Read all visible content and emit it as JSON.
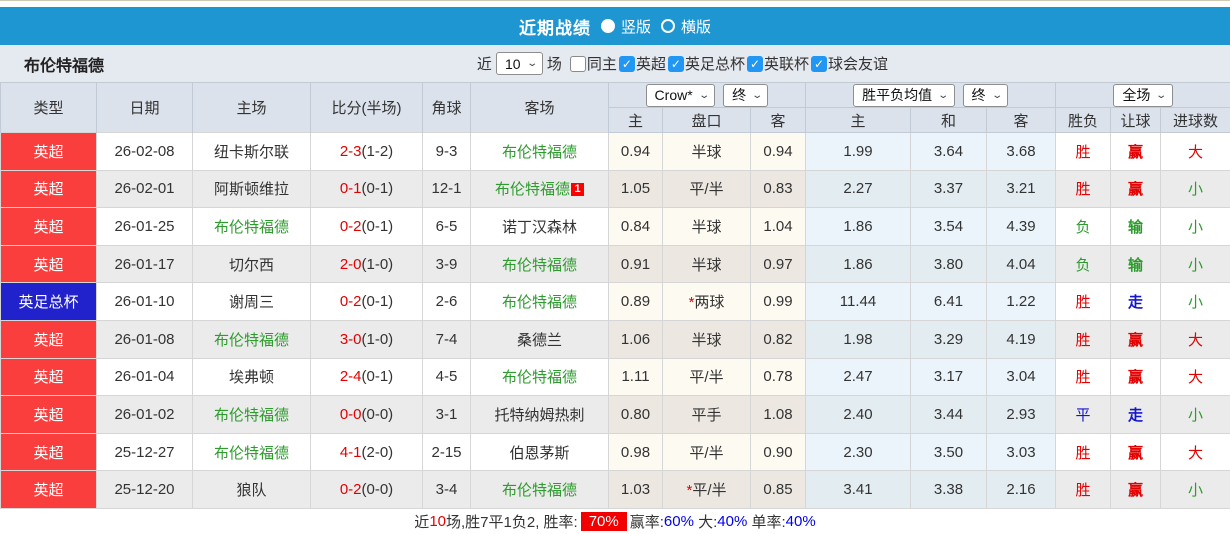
{
  "topbar": {
    "title": "近期战绩",
    "radios": [
      {
        "label": "竖版",
        "selected": true
      },
      {
        "label": "横版",
        "selected": false
      }
    ]
  },
  "filter": {
    "team": "布伦特福德",
    "recent_prefix": "近",
    "recent_value": "10",
    "recent_suffix": "场",
    "checkboxes": [
      {
        "label": "同主",
        "checked": false
      },
      {
        "label": "英超",
        "checked": true
      },
      {
        "label": "英足总杯",
        "checked": true
      },
      {
        "label": "英联杯",
        "checked": true
      },
      {
        "label": "球会友谊",
        "checked": true
      }
    ]
  },
  "table": {
    "left_headers": [
      "类型",
      "日期",
      "主场",
      "比分(半场)",
      "角球",
      "客场"
    ],
    "dropdowns": {
      "odds_company": "Crow*",
      "odds_final": "终",
      "avg_label": "胜平负均值",
      "avg_final": "终",
      "fulltime": "全场"
    },
    "sub_headers": [
      "主",
      "盘口",
      "客",
      "主",
      "和",
      "客",
      "胜负",
      "让球",
      "进球数"
    ],
    "rows": [
      {
        "league": "英超",
        "league_color": "red",
        "date": "26-02-08",
        "home": "纽卡斯尔联",
        "home_team": false,
        "score": "2-3",
        "half": "(1-2)",
        "corners": "9-3",
        "away": "布伦特福德",
        "away_team": true,
        "away_badge": "",
        "o1": "0.94",
        "handicap": "半球",
        "handicap_star": false,
        "o2": "0.94",
        "a1": "1.99",
        "a2": "3.64",
        "a3": "3.68",
        "res": "胜",
        "res_c": "red",
        "hres": "赢",
        "hres_c": "red",
        "goal": "大",
        "goal_c": "red"
      },
      {
        "league": "英超",
        "league_color": "red",
        "date": "26-02-01",
        "home": "阿斯顿维拉",
        "home_team": false,
        "score": "0-1",
        "half": "(0-1)",
        "corners": "12-1",
        "away": "布伦特福德",
        "away_team": true,
        "away_badge": "1",
        "o1": "1.05",
        "handicap": "平/半",
        "handicap_star": false,
        "o2": "0.83",
        "a1": "2.27",
        "a2": "3.37",
        "a3": "3.21",
        "res": "胜",
        "res_c": "red",
        "hres": "赢",
        "hres_c": "red",
        "goal": "小",
        "goal_c": "green"
      },
      {
        "league": "英超",
        "league_color": "red",
        "date": "26-01-25",
        "home": "布伦特福德",
        "home_team": true,
        "score": "0-2",
        "half": "(0-1)",
        "corners": "6-5",
        "away": "诺丁汉森林",
        "away_team": false,
        "away_badge": "",
        "o1": "0.84",
        "handicap": "半球",
        "handicap_star": false,
        "o2": "1.04",
        "a1": "1.86",
        "a2": "3.54",
        "a3": "4.39",
        "res": "负",
        "res_c": "green",
        "hres": "输",
        "hres_c": "green",
        "goal": "小",
        "goal_c": "green"
      },
      {
        "league": "英超",
        "league_color": "red",
        "date": "26-01-17",
        "home": "切尔西",
        "home_team": false,
        "score": "2-0",
        "half": "(1-0)",
        "corners": "3-9",
        "away": "布伦特福德",
        "away_team": true,
        "away_badge": "",
        "o1": "0.91",
        "handicap": "半球",
        "handicap_star": false,
        "o2": "0.97",
        "a1": "1.86",
        "a2": "3.80",
        "a3": "4.04",
        "res": "负",
        "res_c": "green",
        "hres": "输",
        "hres_c": "green",
        "goal": "小",
        "goal_c": "green"
      },
      {
        "league": "英足总杯",
        "league_color": "blue",
        "date": "26-01-10",
        "home": "谢周三",
        "home_team": false,
        "score": "0-2",
        "half": "(0-1)",
        "corners": "2-6",
        "away": "布伦特福德",
        "away_team": true,
        "away_badge": "",
        "o1": "0.89",
        "handicap": "两球",
        "handicap_star": true,
        "o2": "0.99",
        "a1": "11.44",
        "a2": "6.41",
        "a3": "1.22",
        "res": "胜",
        "res_c": "red",
        "hres": "走",
        "hres_c": "blue",
        "goal": "小",
        "goal_c": "green"
      },
      {
        "league": "英超",
        "league_color": "red",
        "date": "26-01-08",
        "home": "布伦特福德",
        "home_team": true,
        "score": "3-0",
        "half": "(1-0)",
        "corners": "7-4",
        "away": "桑德兰",
        "away_team": false,
        "away_badge": "",
        "o1": "1.06",
        "handicap": "半球",
        "handicap_star": false,
        "o2": "0.82",
        "a1": "1.98",
        "a2": "3.29",
        "a3": "4.19",
        "res": "胜",
        "res_c": "red",
        "hres": "赢",
        "hres_c": "red",
        "goal": "大",
        "goal_c": "red"
      },
      {
        "league": "英超",
        "league_color": "red",
        "date": "26-01-04",
        "home": "埃弗顿",
        "home_team": false,
        "score": "2-4",
        "half": "(0-1)",
        "corners": "4-5",
        "away": "布伦特福德",
        "away_team": true,
        "away_badge": "",
        "o1": "1.11",
        "handicap": "平/半",
        "handicap_star": false,
        "o2": "0.78",
        "a1": "2.47",
        "a2": "3.17",
        "a3": "3.04",
        "res": "胜",
        "res_c": "red",
        "hres": "赢",
        "hres_c": "red",
        "goal": "大",
        "goal_c": "red"
      },
      {
        "league": "英超",
        "league_color": "red",
        "date": "26-01-02",
        "home": "布伦特福德",
        "home_team": true,
        "score": "0-0",
        "half": "(0-0)",
        "corners": "3-1",
        "away": "托特纳姆热刺",
        "away_team": false,
        "away_badge": "",
        "o1": "0.80",
        "handicap": "平手",
        "handicap_star": false,
        "o2": "1.08",
        "a1": "2.40",
        "a2": "3.44",
        "a3": "2.93",
        "res": "平",
        "res_c": "blue",
        "hres": "走",
        "hres_c": "blue",
        "goal": "小",
        "goal_c": "green"
      },
      {
        "league": "英超",
        "league_color": "red",
        "date": "25-12-27",
        "home": "布伦特福德",
        "home_team": true,
        "score": "4-1",
        "half": "(2-0)",
        "corners": "2-15",
        "away": "伯恩茅斯",
        "away_team": false,
        "away_badge": "",
        "o1": "0.98",
        "handicap": "平/半",
        "handicap_star": false,
        "o2": "0.90",
        "a1": "2.30",
        "a2": "3.50",
        "a3": "3.03",
        "res": "胜",
        "res_c": "red",
        "hres": "赢",
        "hres_c": "red",
        "goal": "大",
        "goal_c": "red"
      },
      {
        "league": "英超",
        "league_color": "red",
        "date": "25-12-20",
        "home": "狼队",
        "home_team": false,
        "score": "0-2",
        "half": "(0-0)",
        "corners": "3-4",
        "away": "布伦特福德",
        "away_team": true,
        "away_badge": "",
        "o1": "1.03",
        "handicap": "平/半",
        "handicap_star": true,
        "o2": "0.85",
        "a1": "3.41",
        "a2": "3.38",
        "a3": "2.16",
        "res": "胜",
        "res_c": "red",
        "hres": "赢",
        "hres_c": "red",
        "goal": "小",
        "goal_c": "green"
      }
    ]
  },
  "footer": {
    "segments": [
      {
        "text": "近",
        "style": "plain"
      },
      {
        "text": "10",
        "style": "red"
      },
      {
        "text": "场,胜7平1负2, 胜率:",
        "style": "plain"
      },
      {
        "text": "70%",
        "style": "badge"
      },
      {
        "text": "赢率:",
        "style": "plain"
      },
      {
        "text": "60%",
        "style": "blue"
      },
      {
        "text": " 大:",
        "style": "plain"
      },
      {
        "text": "40%",
        "style": "blue"
      },
      {
        "text": " 单率:",
        "style": "plain"
      },
      {
        "text": "40%",
        "style": "blue"
      }
    ]
  },
  "colors": {
    "topbar_blue": "#1d96d2",
    "league_red": "#fa3e3e",
    "league_blue": "#2222cc",
    "team_green": "#2e9b2e",
    "score_red": "#e30000",
    "draw_blue": "#1414cc",
    "pct_blue": "#0000ee",
    "badge_red": "#f00000"
  }
}
